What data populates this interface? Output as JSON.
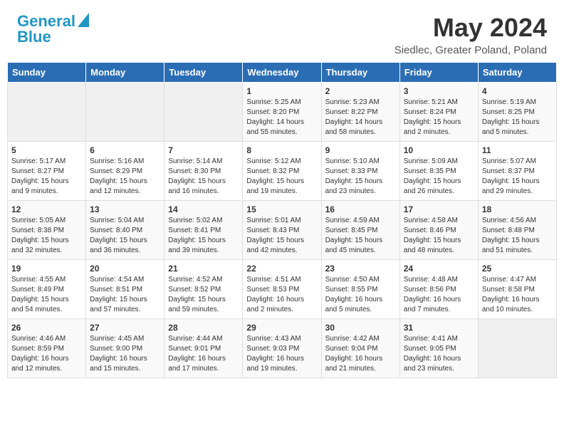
{
  "header": {
    "logo_line1": "General",
    "logo_line2": "Blue",
    "month_title": "May 2024",
    "location": "Siedlec, Greater Poland, Poland"
  },
  "days_of_week": [
    "Sunday",
    "Monday",
    "Tuesday",
    "Wednesday",
    "Thursday",
    "Friday",
    "Saturday"
  ],
  "weeks": [
    [
      {
        "day": "",
        "sunrise": "",
        "sunset": "",
        "daylight": ""
      },
      {
        "day": "",
        "sunrise": "",
        "sunset": "",
        "daylight": ""
      },
      {
        "day": "",
        "sunrise": "",
        "sunset": "",
        "daylight": ""
      },
      {
        "day": "1",
        "sunrise": "Sunrise: 5:25 AM",
        "sunset": "Sunset: 8:20 PM",
        "daylight": "Daylight: 14 hours and 55 minutes."
      },
      {
        "day": "2",
        "sunrise": "Sunrise: 5:23 AM",
        "sunset": "Sunset: 8:22 PM",
        "daylight": "Daylight: 14 hours and 58 minutes."
      },
      {
        "day": "3",
        "sunrise": "Sunrise: 5:21 AM",
        "sunset": "Sunset: 8:24 PM",
        "daylight": "Daylight: 15 hours and 2 minutes."
      },
      {
        "day": "4",
        "sunrise": "Sunrise: 5:19 AM",
        "sunset": "Sunset: 8:25 PM",
        "daylight": "Daylight: 15 hours and 5 minutes."
      }
    ],
    [
      {
        "day": "5",
        "sunrise": "Sunrise: 5:17 AM",
        "sunset": "Sunset: 8:27 PM",
        "daylight": "Daylight: 15 hours and 9 minutes."
      },
      {
        "day": "6",
        "sunrise": "Sunrise: 5:16 AM",
        "sunset": "Sunset: 8:29 PM",
        "daylight": "Daylight: 15 hours and 12 minutes."
      },
      {
        "day": "7",
        "sunrise": "Sunrise: 5:14 AM",
        "sunset": "Sunset: 8:30 PM",
        "daylight": "Daylight: 15 hours and 16 minutes."
      },
      {
        "day": "8",
        "sunrise": "Sunrise: 5:12 AM",
        "sunset": "Sunset: 8:32 PM",
        "daylight": "Daylight: 15 hours and 19 minutes."
      },
      {
        "day": "9",
        "sunrise": "Sunrise: 5:10 AM",
        "sunset": "Sunset: 8:33 PM",
        "daylight": "Daylight: 15 hours and 23 minutes."
      },
      {
        "day": "10",
        "sunrise": "Sunrise: 5:09 AM",
        "sunset": "Sunset: 8:35 PM",
        "daylight": "Daylight: 15 hours and 26 minutes."
      },
      {
        "day": "11",
        "sunrise": "Sunrise: 5:07 AM",
        "sunset": "Sunset: 8:37 PM",
        "daylight": "Daylight: 15 hours and 29 minutes."
      }
    ],
    [
      {
        "day": "12",
        "sunrise": "Sunrise: 5:05 AM",
        "sunset": "Sunset: 8:38 PM",
        "daylight": "Daylight: 15 hours and 32 minutes."
      },
      {
        "day": "13",
        "sunrise": "Sunrise: 5:04 AM",
        "sunset": "Sunset: 8:40 PM",
        "daylight": "Daylight: 15 hours and 36 minutes."
      },
      {
        "day": "14",
        "sunrise": "Sunrise: 5:02 AM",
        "sunset": "Sunset: 8:41 PM",
        "daylight": "Daylight: 15 hours and 39 minutes."
      },
      {
        "day": "15",
        "sunrise": "Sunrise: 5:01 AM",
        "sunset": "Sunset: 8:43 PM",
        "daylight": "Daylight: 15 hours and 42 minutes."
      },
      {
        "day": "16",
        "sunrise": "Sunrise: 4:59 AM",
        "sunset": "Sunset: 8:45 PM",
        "daylight": "Daylight: 15 hours and 45 minutes."
      },
      {
        "day": "17",
        "sunrise": "Sunrise: 4:58 AM",
        "sunset": "Sunset: 8:46 PM",
        "daylight": "Daylight: 15 hours and 48 minutes."
      },
      {
        "day": "18",
        "sunrise": "Sunrise: 4:56 AM",
        "sunset": "Sunset: 8:48 PM",
        "daylight": "Daylight: 15 hours and 51 minutes."
      }
    ],
    [
      {
        "day": "19",
        "sunrise": "Sunrise: 4:55 AM",
        "sunset": "Sunset: 8:49 PM",
        "daylight": "Daylight: 15 hours and 54 minutes."
      },
      {
        "day": "20",
        "sunrise": "Sunrise: 4:54 AM",
        "sunset": "Sunset: 8:51 PM",
        "daylight": "Daylight: 15 hours and 57 minutes."
      },
      {
        "day": "21",
        "sunrise": "Sunrise: 4:52 AM",
        "sunset": "Sunset: 8:52 PM",
        "daylight": "Daylight: 15 hours and 59 minutes."
      },
      {
        "day": "22",
        "sunrise": "Sunrise: 4:51 AM",
        "sunset": "Sunset: 8:53 PM",
        "daylight": "Daylight: 16 hours and 2 minutes."
      },
      {
        "day": "23",
        "sunrise": "Sunrise: 4:50 AM",
        "sunset": "Sunset: 8:55 PM",
        "daylight": "Daylight: 16 hours and 5 minutes."
      },
      {
        "day": "24",
        "sunrise": "Sunrise: 4:48 AM",
        "sunset": "Sunset: 8:56 PM",
        "daylight": "Daylight: 16 hours and 7 minutes."
      },
      {
        "day": "25",
        "sunrise": "Sunrise: 4:47 AM",
        "sunset": "Sunset: 8:58 PM",
        "daylight": "Daylight: 16 hours and 10 minutes."
      }
    ],
    [
      {
        "day": "26",
        "sunrise": "Sunrise: 4:46 AM",
        "sunset": "Sunset: 8:59 PM",
        "daylight": "Daylight: 16 hours and 12 minutes."
      },
      {
        "day": "27",
        "sunrise": "Sunrise: 4:45 AM",
        "sunset": "Sunset: 9:00 PM",
        "daylight": "Daylight: 16 hours and 15 minutes."
      },
      {
        "day": "28",
        "sunrise": "Sunrise: 4:44 AM",
        "sunset": "Sunset: 9:01 PM",
        "daylight": "Daylight: 16 hours and 17 minutes."
      },
      {
        "day": "29",
        "sunrise": "Sunrise: 4:43 AM",
        "sunset": "Sunset: 9:03 PM",
        "daylight": "Daylight: 16 hours and 19 minutes."
      },
      {
        "day": "30",
        "sunrise": "Sunrise: 4:42 AM",
        "sunset": "Sunset: 9:04 PM",
        "daylight": "Daylight: 16 hours and 21 minutes."
      },
      {
        "day": "31",
        "sunrise": "Sunrise: 4:41 AM",
        "sunset": "Sunset: 9:05 PM",
        "daylight": "Daylight: 16 hours and 23 minutes."
      },
      {
        "day": "",
        "sunrise": "",
        "sunset": "",
        "daylight": ""
      }
    ]
  ]
}
